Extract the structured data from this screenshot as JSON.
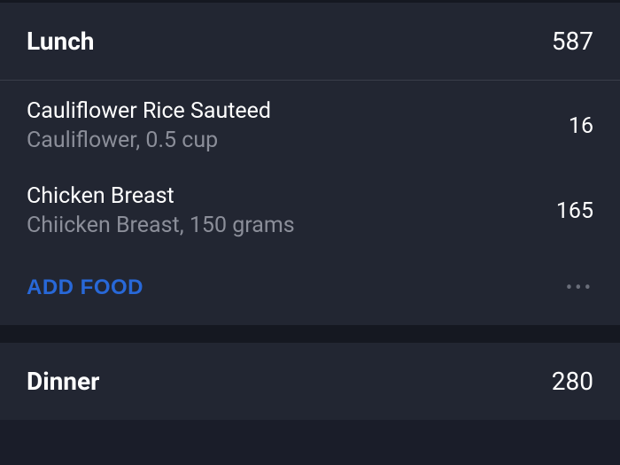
{
  "meals": {
    "lunch": {
      "title": "Lunch",
      "total_calories": "587",
      "items": [
        {
          "name": "Cauliflower Rice Sauteed",
          "details": "Cauliflower, 0.5 cup",
          "calories": "16"
        },
        {
          "name": "Chicken Breast",
          "details": "Chiicken Breast, 150 grams",
          "calories": "165"
        }
      ],
      "add_food_label": "ADD FOOD"
    },
    "dinner": {
      "title": "Dinner",
      "total_calories": "280"
    }
  }
}
